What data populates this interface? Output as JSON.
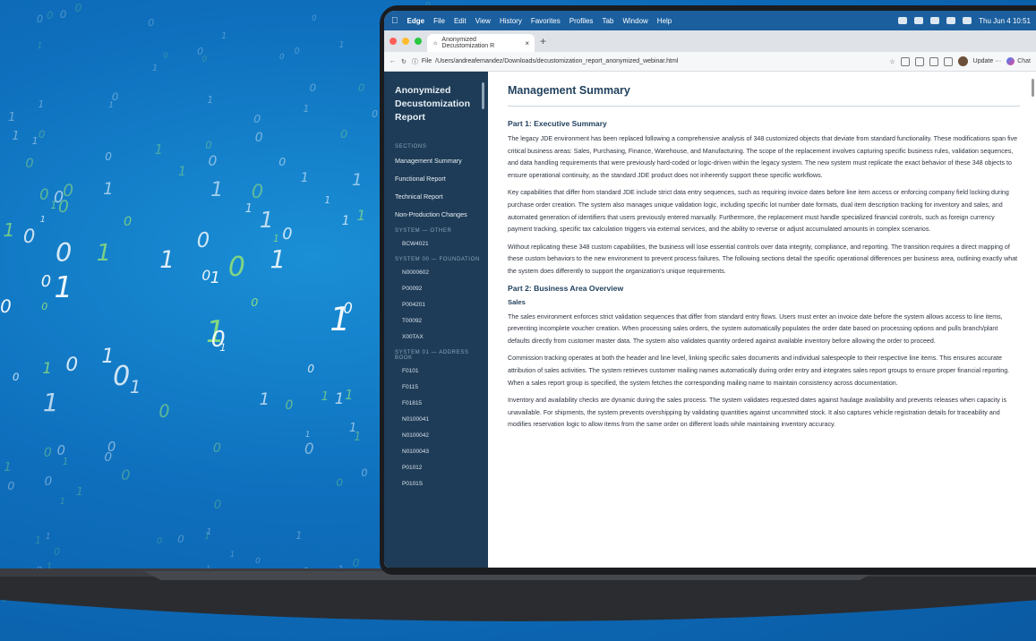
{
  "menubar": {
    "app": "Edge",
    "items": [
      "File",
      "Edit",
      "View",
      "History",
      "Favorites",
      "Profiles",
      "Tab",
      "Window",
      "Help"
    ],
    "clock": "Thu Jun 4  10:51"
  },
  "browser": {
    "tab_title": "Anonymized Decustomization R",
    "url_label": "File",
    "url": "/Users/andreafernandez/Downloads/decustomization_report_anonymized_webinar.html",
    "update_label": "Update",
    "chat_label": "Chat"
  },
  "sidebar": {
    "title_line1": "Anonymized",
    "title_line2": "Decustomization Report",
    "sections_heading": "SECTIONS",
    "nav": [
      "Management Summary",
      "Functional Report",
      "Technical Report",
      "Non-Production Changes"
    ],
    "group_other": "SYSTEM — OTHER",
    "other_items": [
      "BCW4021"
    ],
    "group_00": "SYSTEM 00 — FOUNDATION",
    "items_00": [
      "N0000602",
      "P00092",
      "P004201",
      "T00092",
      "X00TAX"
    ],
    "group_01": "SYSTEM 01 — ADDRESS BOOK",
    "items_01": [
      "F0101",
      "F0115",
      "F01815",
      "N0100041",
      "N0100042",
      "N0100043",
      "P01012",
      "P0101S"
    ]
  },
  "content": {
    "heading": "Management Summary",
    "part1": "Part 1: Executive Summary",
    "p1": "The legacy JDE environment has been replaced following a comprehensive analysis of 348 customized objects that deviate from standard functionality. These modifications span five critical business areas: Sales, Purchasing, Finance, Warehouse, and Manufacturing. The scope of the replacement involves capturing specific business rules, validation sequences, and data handling requirements that were previously hard-coded or logic-driven within the legacy system. The new system must replicate the exact behavior of these 348 objects to ensure operational continuity, as the standard JDE product does not inherently support these specific workflows.",
    "p2": "Key capabilities that differ from standard JDE include strict data entry sequences, such as requiring invoice dates before line item access or enforcing company field locking during purchase order creation. The system also manages unique validation logic, including specific lot number date formats, dual item description tracking for inventory and sales, and automated generation of identifiers that users previously entered manually. Furthermore, the replacement must handle specialized financial controls, such as foreign currency payment tracking, specific tax calculation triggers via external services, and the ability to reverse or adjust accumulated amounts in complex scenarios.",
    "p3": "Without replicating these 348 custom capabilities, the business will lose essential controls over data integrity, compliance, and reporting. The transition requires a direct mapping of these custom behaviors to the new environment to prevent process failures. The following sections detail the specific operational differences per business area, outlining exactly what the system does differently to support the organization's unique requirements.",
    "part2": "Part 2: Business Area Overview",
    "sales": "Sales",
    "s1": "The sales environment enforces strict validation sequences that differ from standard entry flows. Users must enter an invoice date before the system allows access to line items, preventing incomplete voucher creation. When processing sales orders, the system automatically populates the order date based on processing options and pulls branch/plant defaults directly from customer master data. The system also validates quantity ordered against available inventory before allowing the order to proceed.",
    "s2": "Commission tracking operates at both the header and line level, linking specific sales documents and individual salespeople to their respective line items. This ensures accurate attribution of sales activities. The system retrieves customer mailing names automatically during order entry and integrates sales report groups to ensure proper financial reporting. When a sales report group is specified, the system fetches the corresponding mailing name to maintain consistency across documentation.",
    "s3": "Inventory and availability checks are dynamic during the sales process. The system validates requested dates against haulage availability and prevents releases when capacity is unavailable. For shipments, the system prevents overshipping by validating quantities against uncommitted stock. It also captures vehicle registration details for traceability and modifies reservation logic to allow items from the same order on different loads while maintaining inventory accuracy."
  },
  "colors": {
    "background": "#0e6fbd",
    "sidebar": "#1e3c57",
    "heading": "#22425e",
    "digit_green": "#8fe07a",
    "digit_white": "#ffffff"
  }
}
